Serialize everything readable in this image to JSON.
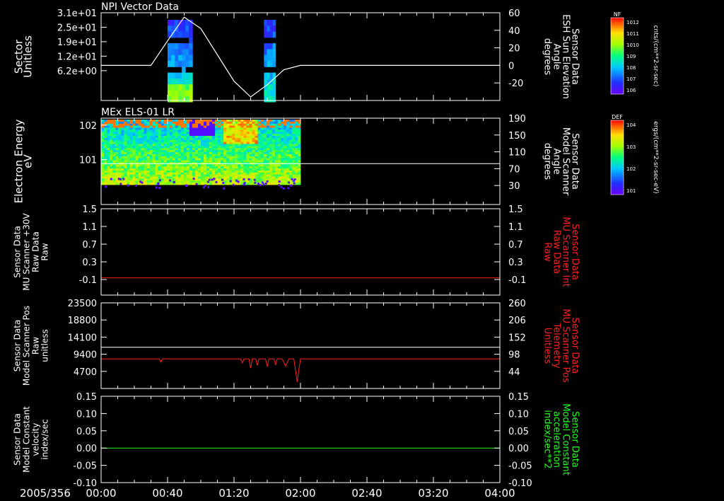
{
  "date_label": "2005/356",
  "x_ticks": [
    "00:00",
    "00:40",
    "01:20",
    "02:00",
    "02:40",
    "03:20",
    "04:00"
  ],
  "chart_data": [
    {
      "type": "heatmap",
      "title": "NPI Vector Data",
      "ylabel_left": [
        "Sector",
        "Unitless"
      ],
      "ylabel_right": [
        "Sensor Data",
        "ESH Sun Elevation",
        "Angle",
        "degrees"
      ],
      "left_ticks": [
        "3.1e+01",
        "2.5e+01",
        "1.9e+01",
        "1.2e+01",
        "6.2e+00"
      ],
      "right_ticks": [
        "60",
        "40",
        "20",
        "0",
        "-20"
      ],
      "ylim_right": [
        -40,
        60
      ],
      "colorbar": {
        "label": "NF",
        "units": "cnts/(cm**2-sr-sec)",
        "ticks": [
          "10^12",
          "10^11",
          "10^10",
          "10^9",
          "10^8",
          "10^7",
          "10^6"
        ]
      },
      "overlay_line": {
        "name": "Sun Elevation Angle",
        "x": [
          "00:00",
          "00:30",
          "00:40",
          "00:50",
          "01:00",
          "01:10",
          "01:20",
          "01:30",
          "01:40",
          "01:50",
          "02:00",
          "04:00"
        ],
        "y": [
          0,
          0,
          28,
          55,
          42,
          12,
          -18,
          -36,
          -22,
          -5,
          0,
          0
        ]
      },
      "data_intervals": [
        [
          "00:40",
          "00:55"
        ],
        [
          "01:38",
          "01:45"
        ]
      ]
    },
    {
      "type": "heatmap",
      "title": "MEx ELS-01 LR",
      "ylabel_left": [
        "Electron Energy",
        "eV"
      ],
      "ylabel_right": [
        "Sensor Data",
        "Model Scanner",
        "Angle",
        "degrees"
      ],
      "left_ticks": [
        "10^2",
        "10^1"
      ],
      "right_ticks": [
        "190",
        "150",
        "110",
        "70",
        "30"
      ],
      "ylim_right": [
        0,
        190
      ],
      "colorbar": {
        "label": "DEF",
        "units": "ergs/(cm**2-sr-sec-eV)",
        "ticks": [
          "10^4",
          "10^3",
          "10^2",
          "10^1"
        ]
      },
      "overlay_line": {
        "name": "Model Scanner Angle",
        "x": [
          "00:00",
          "04:00"
        ],
        "y": [
          90,
          90
        ]
      },
      "data_interval": [
        "00:00",
        "02:00"
      ]
    },
    {
      "type": "line",
      "ylabel_left": [
        "Sensor Data",
        "MU Scanner +30V",
        "Raw Data",
        "Raw"
      ],
      "ylabel_right": [
        "Sensor Data",
        "MU Scanner Int",
        "Raw Data",
        "Raw"
      ],
      "left_ticks": [
        "1.5",
        "1.1",
        "0.7",
        "0.3",
        "-0.1"
      ],
      "right_ticks": [
        "1.5",
        "1.1",
        "0.7",
        "0.3",
        "-0.1"
      ],
      "ylim": [
        -0.5,
        1.5
      ],
      "series": [
        {
          "x": [
            "00:00",
            "04:00"
          ],
          "y": [
            -0.1,
            -0.1
          ],
          "color": "#ff2020"
        }
      ]
    },
    {
      "type": "line",
      "ylabel_left": [
        "Sensor Data",
        "Model Scanner Pos",
        "Raw",
        "unitless"
      ],
      "ylabel_right": [
        "Sensor Data",
        "MU Scanner Pos",
        "Telemetry",
        "Unitless"
      ],
      "left_ticks": [
        "23500",
        "18800",
        "14100",
        "9400",
        "4700"
      ],
      "right_ticks": [
        "260",
        "206",
        "152",
        "98",
        "44"
      ],
      "ylim_left": [
        0,
        23500
      ],
      "ylim_right": [
        0,
        260
      ],
      "series": [
        {
          "axis": "left",
          "color": "#ffffff",
          "x": [
            "00:00",
            "04:00"
          ],
          "y": [
            11300,
            11300
          ]
        },
        {
          "axis": "right",
          "color": "#ff2020",
          "x": [
            "00:00",
            "00:35",
            "00:36",
            "00:37",
            "01:24",
            "01:25",
            "01:26",
            "01:29",
            "01:30",
            "01:31",
            "01:33",
            "01:34",
            "01:35",
            "01:39",
            "01:40",
            "01:41",
            "01:44",
            "01:45",
            "01:46",
            "01:49",
            "01:51",
            "01:53",
            "01:56",
            "01:58",
            "02:00",
            "04:00"
          ],
          "y": [
            90,
            90,
            80,
            90,
            90,
            78,
            90,
            90,
            62,
            90,
            90,
            70,
            90,
            90,
            66,
            90,
            90,
            72,
            90,
            90,
            68,
            90,
            90,
            20,
            90,
            90
          ]
        }
      ]
    },
    {
      "type": "line",
      "ylabel_left": [
        "Sensor Data",
        "Model Constant",
        "velocity",
        "index/sec"
      ],
      "ylabel_right": [
        "Sensor Data",
        "Model Constant",
        "acceleration",
        "index/sec**2"
      ],
      "left_ticks": [
        "0.15",
        "0.10",
        "0.05",
        "0.00",
        "-0.05",
        "-0.10"
      ],
      "right_ticks": [
        "0.15",
        "0.10",
        "0.05",
        "0.00",
        "-0.05",
        "-0.10"
      ],
      "ylim": [
        -0.1,
        0.15
      ],
      "series": [
        {
          "x": [
            "00:00",
            "04:00"
          ],
          "y": [
            0,
            0
          ],
          "color": "#20ff20"
        }
      ]
    }
  ],
  "colors": {
    "background": "#000000",
    "axes": "#ffffff",
    "red_label": "#ff2020",
    "green_label": "#20ff20"
  }
}
